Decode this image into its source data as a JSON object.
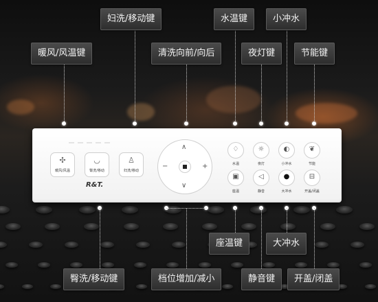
{
  "labels": {
    "warm_air": "暖风/风温键",
    "lady_wash": "妇洗/移动键",
    "wash_position": "清洗向前/向后",
    "water_temp": "水温键",
    "night_light": "夜灯键",
    "small_flush": "小冲水",
    "eco": "节能键",
    "hip_wash": "臀洗/移动键",
    "level_adjust": "档位增加/减小",
    "seat_temp": "座温键",
    "big_flush": "大冲水",
    "mute": "静音键",
    "lid": "开盖/闭盖"
  },
  "remote": {
    "brand": "R&T.",
    "buttons": {
      "warm": {
        "label": "暖风/风温",
        "icon": "fan-icon"
      },
      "hip": {
        "label": "臀洗/移动",
        "icon": "hip-wash-icon"
      },
      "lady": {
        "label": "妇洗/移动",
        "icon": "lady-wash-icon"
      },
      "water_temp": {
        "label": "水温",
        "icon": "water-drop-temp-icon"
      },
      "night": {
        "label": "夜灯",
        "icon": "sun-icon"
      },
      "small_flush": {
        "label": "小冲水",
        "icon": "half-drop-icon"
      },
      "eco": {
        "label": "节能",
        "icon": "leaf-icon"
      },
      "seat_temp": {
        "label": "座温",
        "icon": "seat-heat-icon"
      },
      "mute": {
        "label": "静音",
        "icon": "speaker-icon"
      },
      "big_flush": {
        "label": "大冲水",
        "icon": "full-drop-icon"
      },
      "lid": {
        "label": "开盖/闭盖",
        "icon": "lid-icon"
      }
    },
    "dpad": {
      "up": "∧",
      "down": "∨",
      "left": "−",
      "right": "+"
    }
  }
}
